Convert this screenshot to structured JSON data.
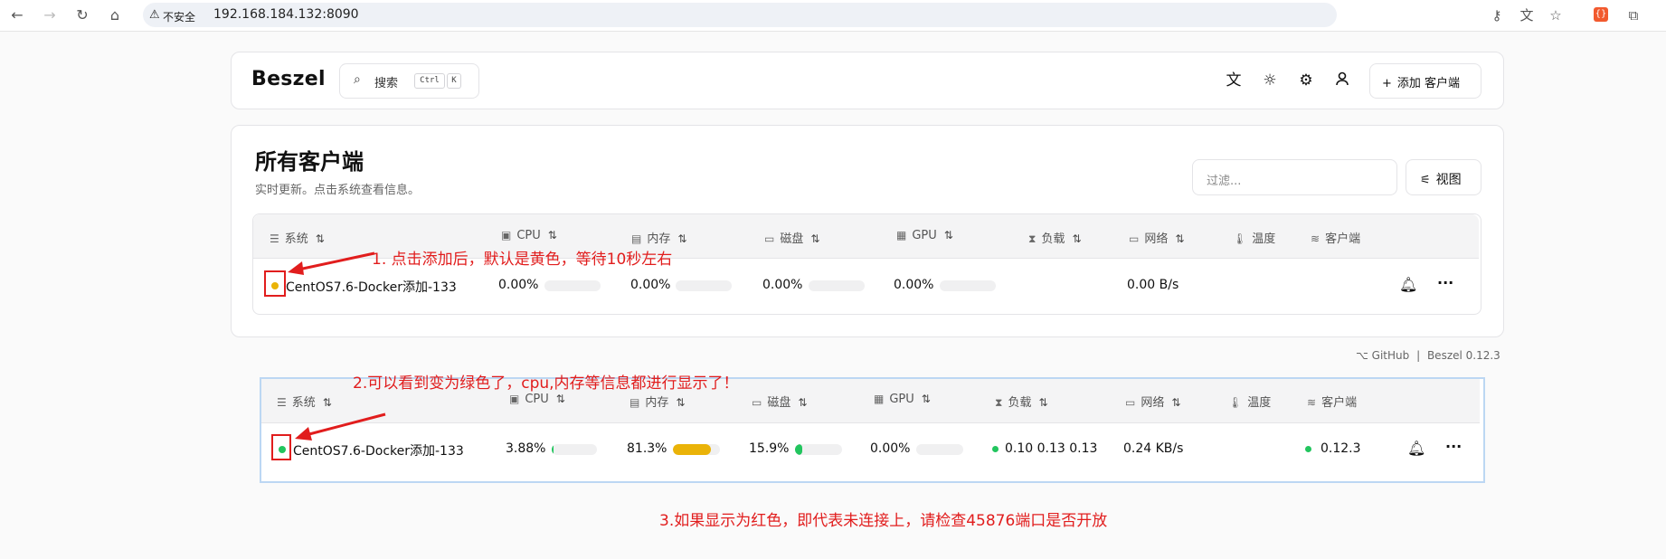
{
  "browser": {
    "security_label": "不安全",
    "url": "192.168.184.132:8090"
  },
  "header": {
    "logo": "Beszel",
    "search_placeholder": "搜索",
    "kbd_ctrl": "Ctrl",
    "kbd_k": "K",
    "add_client_label": "添加 客户端"
  },
  "page": {
    "title": "所有客户端",
    "subtitle": "实时更新。点击系统查看信息。",
    "filter_placeholder": "过滤...",
    "view_label": "视图"
  },
  "columns": {
    "system": "系统",
    "cpu": "CPU",
    "memory": "内存",
    "disk": "磁盘",
    "gpu": "GPU",
    "load": "负载",
    "network": "网络",
    "temp": "温度",
    "agent": "客户端"
  },
  "row1": {
    "status_color": "#eab308",
    "name": "CentOS7.6-Docker添加-133",
    "cpu": "0.00%",
    "cpu_level": 0,
    "memory": "0.00%",
    "memory_level": 0,
    "disk": "0.00%",
    "disk_level": 0,
    "gpu": "0.00%",
    "gpu_level": 0,
    "network": "0.00 B/s"
  },
  "row2": {
    "status_color": "#22c55e",
    "name": "CentOS7.6-Docker添加-133",
    "cpu": "3.88%",
    "cpu_level": 0.04,
    "memory": "81.3%",
    "memory_level": 0.813,
    "disk": "15.9%",
    "disk_level": 0.159,
    "gpu": "0.00%",
    "gpu_level": 0,
    "load": "0.10 0.13 0.13",
    "network": "0.24 KB/s",
    "agent": "0.12.3"
  },
  "footer": {
    "github": "GitHub",
    "separator": "|",
    "version": "Beszel 0.12.3"
  },
  "annotations": {
    "note1": "1. 点击添加后，默认是黄色，等待10秒左右",
    "note2": "2.可以看到变为绿色了，cpu,内存等信息都进行显示了！",
    "note3": "3.如果显示为红色，即代表未连接上，请检查45876端口是否开放"
  },
  "colors": {
    "accent_red": "#e11d1d",
    "memory_bar": "#eab308",
    "disk_bar": "#22c55e",
    "cpu_bar": "#22c55e"
  }
}
